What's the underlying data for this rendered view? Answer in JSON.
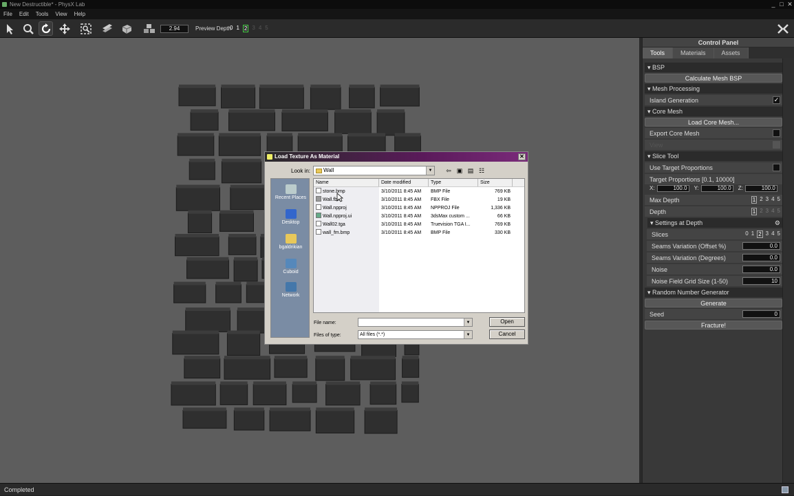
{
  "window": {
    "title": "New Destructible* - PhysX Lab",
    "controls": [
      "_",
      "□",
      "✕"
    ]
  },
  "menu": [
    "File",
    "Edit",
    "Tools",
    "View",
    "Help"
  ],
  "toolbar": {
    "value": "2.94",
    "preview_depth_label": "Preview Depth",
    "preview_depths": [
      "0",
      "1",
      "2",
      "3",
      "4",
      "5"
    ],
    "preview_depth_selected": "2"
  },
  "panel": {
    "title": "Control Panel",
    "tabs": [
      "Tools",
      "Materials",
      "Assets"
    ],
    "bsp": {
      "header": "BSP",
      "button": "Calculate Mesh BSP"
    },
    "mesh_processing": {
      "header": "Mesh Processing",
      "island_generation": "Island Generation"
    },
    "core_mesh": {
      "header": "Core Mesh",
      "load_button": "Load Core Mesh...",
      "export_label": "Export Core Mesh",
      "disabled_label": "View"
    },
    "slice_tool": {
      "header": "Slice Tool",
      "use_target": "Use Target Proportions",
      "target_label": "Target Proportions [0.1, 10000]",
      "x_label": "X:",
      "x": "100.0",
      "y_label": "Y:",
      "y": "100.0",
      "z_label": "Z:",
      "z": "100.0",
      "max_depth_label": "Max Depth",
      "depth_label": "Depth",
      "depth_nums": [
        "1",
        "2",
        "3",
        "4",
        "5"
      ]
    },
    "settings_at_depth": {
      "header": "Settings at Depth",
      "slices_label": "Slices",
      "slices_nums": [
        "0",
        "1",
        "2",
        "3",
        "4",
        "5"
      ],
      "slices_selected": "2",
      "seams_offset_label": "Seams Variation (Offset %)",
      "seams_offset": "0.0",
      "seams_degrees_label": "Seams Variation (Degrees)",
      "seams_degrees": "0.0",
      "noise_label": "Noise",
      "noise": "0.0",
      "noise_grid_label": "Noise Field Grid Size (1-50)",
      "noise_grid": "10"
    },
    "rng": {
      "header": "Random Number Generator",
      "generate": "Generate",
      "seed_label": "Seed",
      "seed": "0"
    },
    "fracture": "Fracture!"
  },
  "status": "Completed",
  "dialog": {
    "title": "Load Texture As Material",
    "close": "✕",
    "look_in_label": "Look in:",
    "look_in_value": "Wall",
    "places": [
      "Recent Places",
      "Desktop",
      "bgaldrikian",
      "Cuboid",
      "Network"
    ],
    "columns": [
      "Name",
      "Date modified",
      "Type",
      "Size"
    ],
    "files": [
      {
        "name": "stone.bmp",
        "date": "3/10/2011 8:45 AM",
        "type": "BMP File",
        "size": "769 KB"
      },
      {
        "name": "Wall.fbx",
        "date": "3/10/2011 8:45 AM",
        "type": "FBX File",
        "size": "19 KB"
      },
      {
        "name": "Wall.npproj",
        "date": "3/10/2011 8:45 AM",
        "type": "NPPROJ File",
        "size": "1,336 KB"
      },
      {
        "name": "Wall.npproj.ui",
        "date": "3/10/2011 8:45 AM",
        "type": "3dsMax custom ...",
        "size": "66 KB"
      },
      {
        "name": "Wall02.tga",
        "date": "3/10/2011 8:45 AM",
        "type": "Truevision TGA I...",
        "size": "769 KB"
      },
      {
        "name": "wall_fm.bmp",
        "date": "3/10/2011 8:45 AM",
        "type": "BMP File",
        "size": "330 KB"
      }
    ],
    "file_name_label": "File name:",
    "file_name_value": "",
    "files_of_type_label": "Files of type:",
    "files_of_type_value": "All files (*.*)",
    "open": "Open",
    "cancel": "Cancel"
  }
}
